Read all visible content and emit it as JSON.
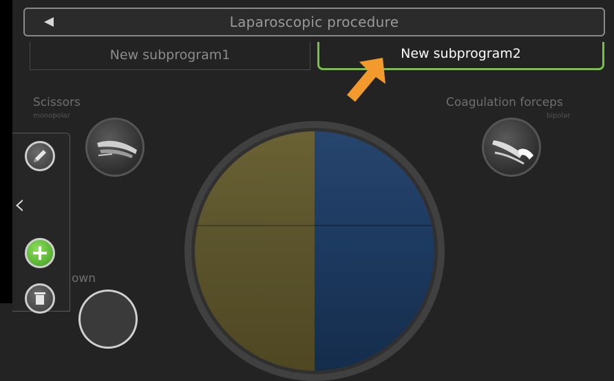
{
  "header": {
    "title": "Laparoscopic procedure"
  },
  "tabs": [
    {
      "label": "New subprogram1",
      "active": false
    },
    {
      "label": "New subprogram2",
      "active": true
    }
  ],
  "tools": {
    "left": {
      "label": "Scissors",
      "sub": "monopolar",
      "icon": "scissors-icon"
    },
    "right": {
      "label": "Coagulation forceps",
      "sub": "bipolar",
      "icon": "forceps-icon"
    }
  },
  "partial_tool": {
    "label": "own"
  },
  "colors": {
    "accent": "#76c442",
    "arrow": "#f39a2c",
    "left_quadrant": "#5b542c",
    "right_quadrant": "#1d3a60"
  }
}
